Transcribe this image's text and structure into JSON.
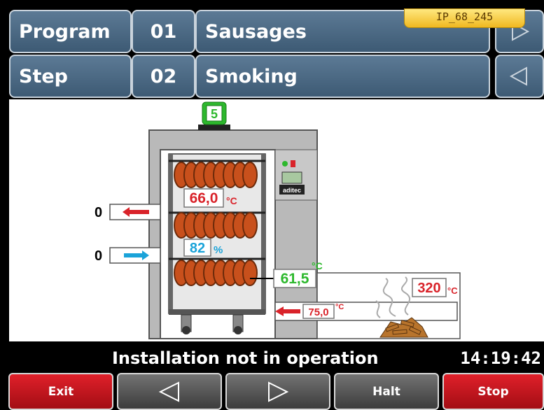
{
  "program": {
    "label": "Program",
    "number": "01",
    "name": "Sausages"
  },
  "step": {
    "label": "Step",
    "number": "02",
    "name": "Smoking"
  },
  "ip_badge": "IP_68_245",
  "scene": {
    "smoke_generator_number": "5",
    "chamber_temp": "66,0",
    "chamber_temp_unit": "°C",
    "humidity": "82",
    "humidity_unit": "%",
    "core_temp": "61,5",
    "core_temp_unit": "°C",
    "smoke_temp": "320",
    "smoke_temp_unit": "°C",
    "smoke_inlet_temp": "75,0",
    "smoke_inlet_temp_unit": "°C",
    "exhaust_value": "0",
    "fresh_air_value": "0",
    "controller_brand": "aditec"
  },
  "status": {
    "message": "Installation not in operation",
    "time": "14:19:42"
  },
  "footer": {
    "exit": "Exit",
    "halt": "Halt",
    "stop": "Stop"
  },
  "colors": {
    "red": "#d9232a",
    "cyan": "#1aa3d9",
    "green": "#2db82d",
    "header": "#4a6883"
  }
}
